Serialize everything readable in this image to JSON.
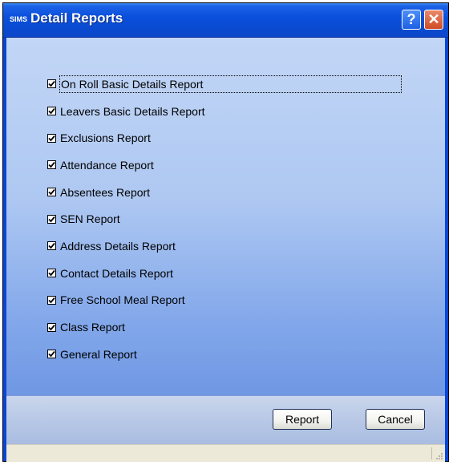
{
  "window": {
    "app_icon_text": "SIMS",
    "title": "Detail Reports",
    "help_symbol": "?",
    "close_symbol": "✕"
  },
  "reports": [
    {
      "label": "On Roll Basic Details Report",
      "checked": true
    },
    {
      "label": "Leavers Basic Details Report",
      "checked": true
    },
    {
      "label": "Exclusions Report",
      "checked": true
    },
    {
      "label": "Attendance Report",
      "checked": true
    },
    {
      "label": "Absentees Report",
      "checked": true
    },
    {
      "label": "SEN Report",
      "checked": true
    },
    {
      "label": "Address Details Report",
      "checked": true
    },
    {
      "label": "Contact Details Report",
      "checked": true
    },
    {
      "label": "Free School Meal Report",
      "checked": true
    },
    {
      "label": "Class Report",
      "checked": true
    },
    {
      "label": "General Report",
      "checked": true
    }
  ],
  "buttons": {
    "report_label": "Report",
    "cancel_label": "Cancel"
  },
  "colors": {
    "title_bar": "#0a50dc",
    "content_top": "#c2d6f6",
    "content_bottom": "#6f97e3",
    "footer": "#b8c8e6",
    "status_bar": "#ece9d8"
  },
  "icons": {
    "help": "help-icon",
    "close": "close-icon",
    "check": "checkmark-icon",
    "grip": "resize-grip-icon"
  }
}
